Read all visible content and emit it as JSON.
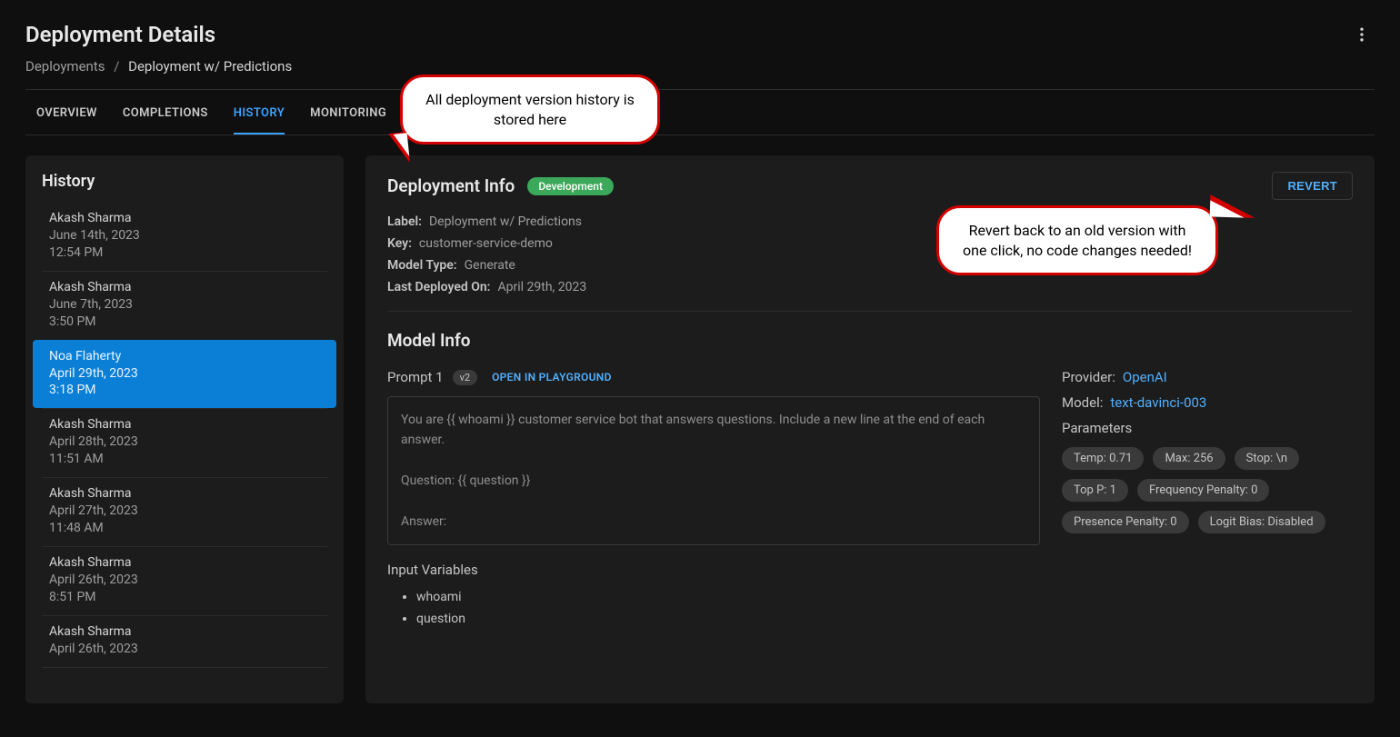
{
  "page": {
    "title": "Deployment Details"
  },
  "breadcrumb": {
    "parent": "Deployments",
    "separator": "/",
    "current": "Deployment w/ Predictions"
  },
  "tabs": [
    {
      "label": "OVERVIEW",
      "active": false
    },
    {
      "label": "COMPLETIONS",
      "active": false
    },
    {
      "label": "HISTORY",
      "active": true
    },
    {
      "label": "MONITORING",
      "active": false
    }
  ],
  "sidebar": {
    "title": "History",
    "items": [
      {
        "name": "Akash Sharma",
        "date": "June 14th, 2023",
        "time": "12:54 PM",
        "selected": false
      },
      {
        "name": "Akash Sharma",
        "date": "June 7th, 2023",
        "time": "3:50 PM",
        "selected": false
      },
      {
        "name": "Noa Flaherty",
        "date": "April 29th, 2023",
        "time": "3:18 PM",
        "selected": true
      },
      {
        "name": "Akash Sharma",
        "date": "April 28th, 2023",
        "time": "11:51 AM",
        "selected": false
      },
      {
        "name": "Akash Sharma",
        "date": "April 27th, 2023",
        "time": "11:48 AM",
        "selected": false
      },
      {
        "name": "Akash Sharma",
        "date": "April 26th, 2023",
        "time": "8:51 PM",
        "selected": false
      },
      {
        "name": "Akash Sharma",
        "date": "April 26th, 2023",
        "time": "",
        "selected": false
      }
    ]
  },
  "deployment_info": {
    "heading": "Deployment Info",
    "env_badge": "Development",
    "revert_label": "REVERT",
    "fields": {
      "label_key": "Label:",
      "label_val": "Deployment w/ Predictions",
      "key_key": "Key:",
      "key_val": "customer-service-demo",
      "model_type_key": "Model Type:",
      "model_type_val": "Generate",
      "last_deployed_key": "Last Deployed On:",
      "last_deployed_val": "April 29th, 2023"
    }
  },
  "model_info": {
    "heading": "Model Info",
    "prompt_label": "Prompt 1",
    "version_pill": "v2",
    "open_playground": "OPEN IN PLAYGROUND",
    "prompt_text": "You are {{ whoami }} customer service bot that answers questions. Include a new line at the end of each answer.\n\nQuestion: {{ question }}\n\nAnswer:",
    "input_vars_title": "Input Variables",
    "input_vars": [
      "whoami",
      "question"
    ],
    "provider_key": "Provider:",
    "provider_val": "OpenAI",
    "model_key": "Model:",
    "model_val": "text-davinci-003",
    "params_title": "Parameters",
    "params": [
      "Temp: 0.71",
      "Max: 256",
      "Stop: \\n",
      "Top P: 1",
      "Frequency Penalty: 0",
      "Presence Penalty: 0",
      "Logit Bias: Disabled"
    ]
  },
  "callouts": {
    "c1": "All deployment version history is stored here",
    "c2": "Revert back to an old version with one click, no code changes needed!"
  }
}
